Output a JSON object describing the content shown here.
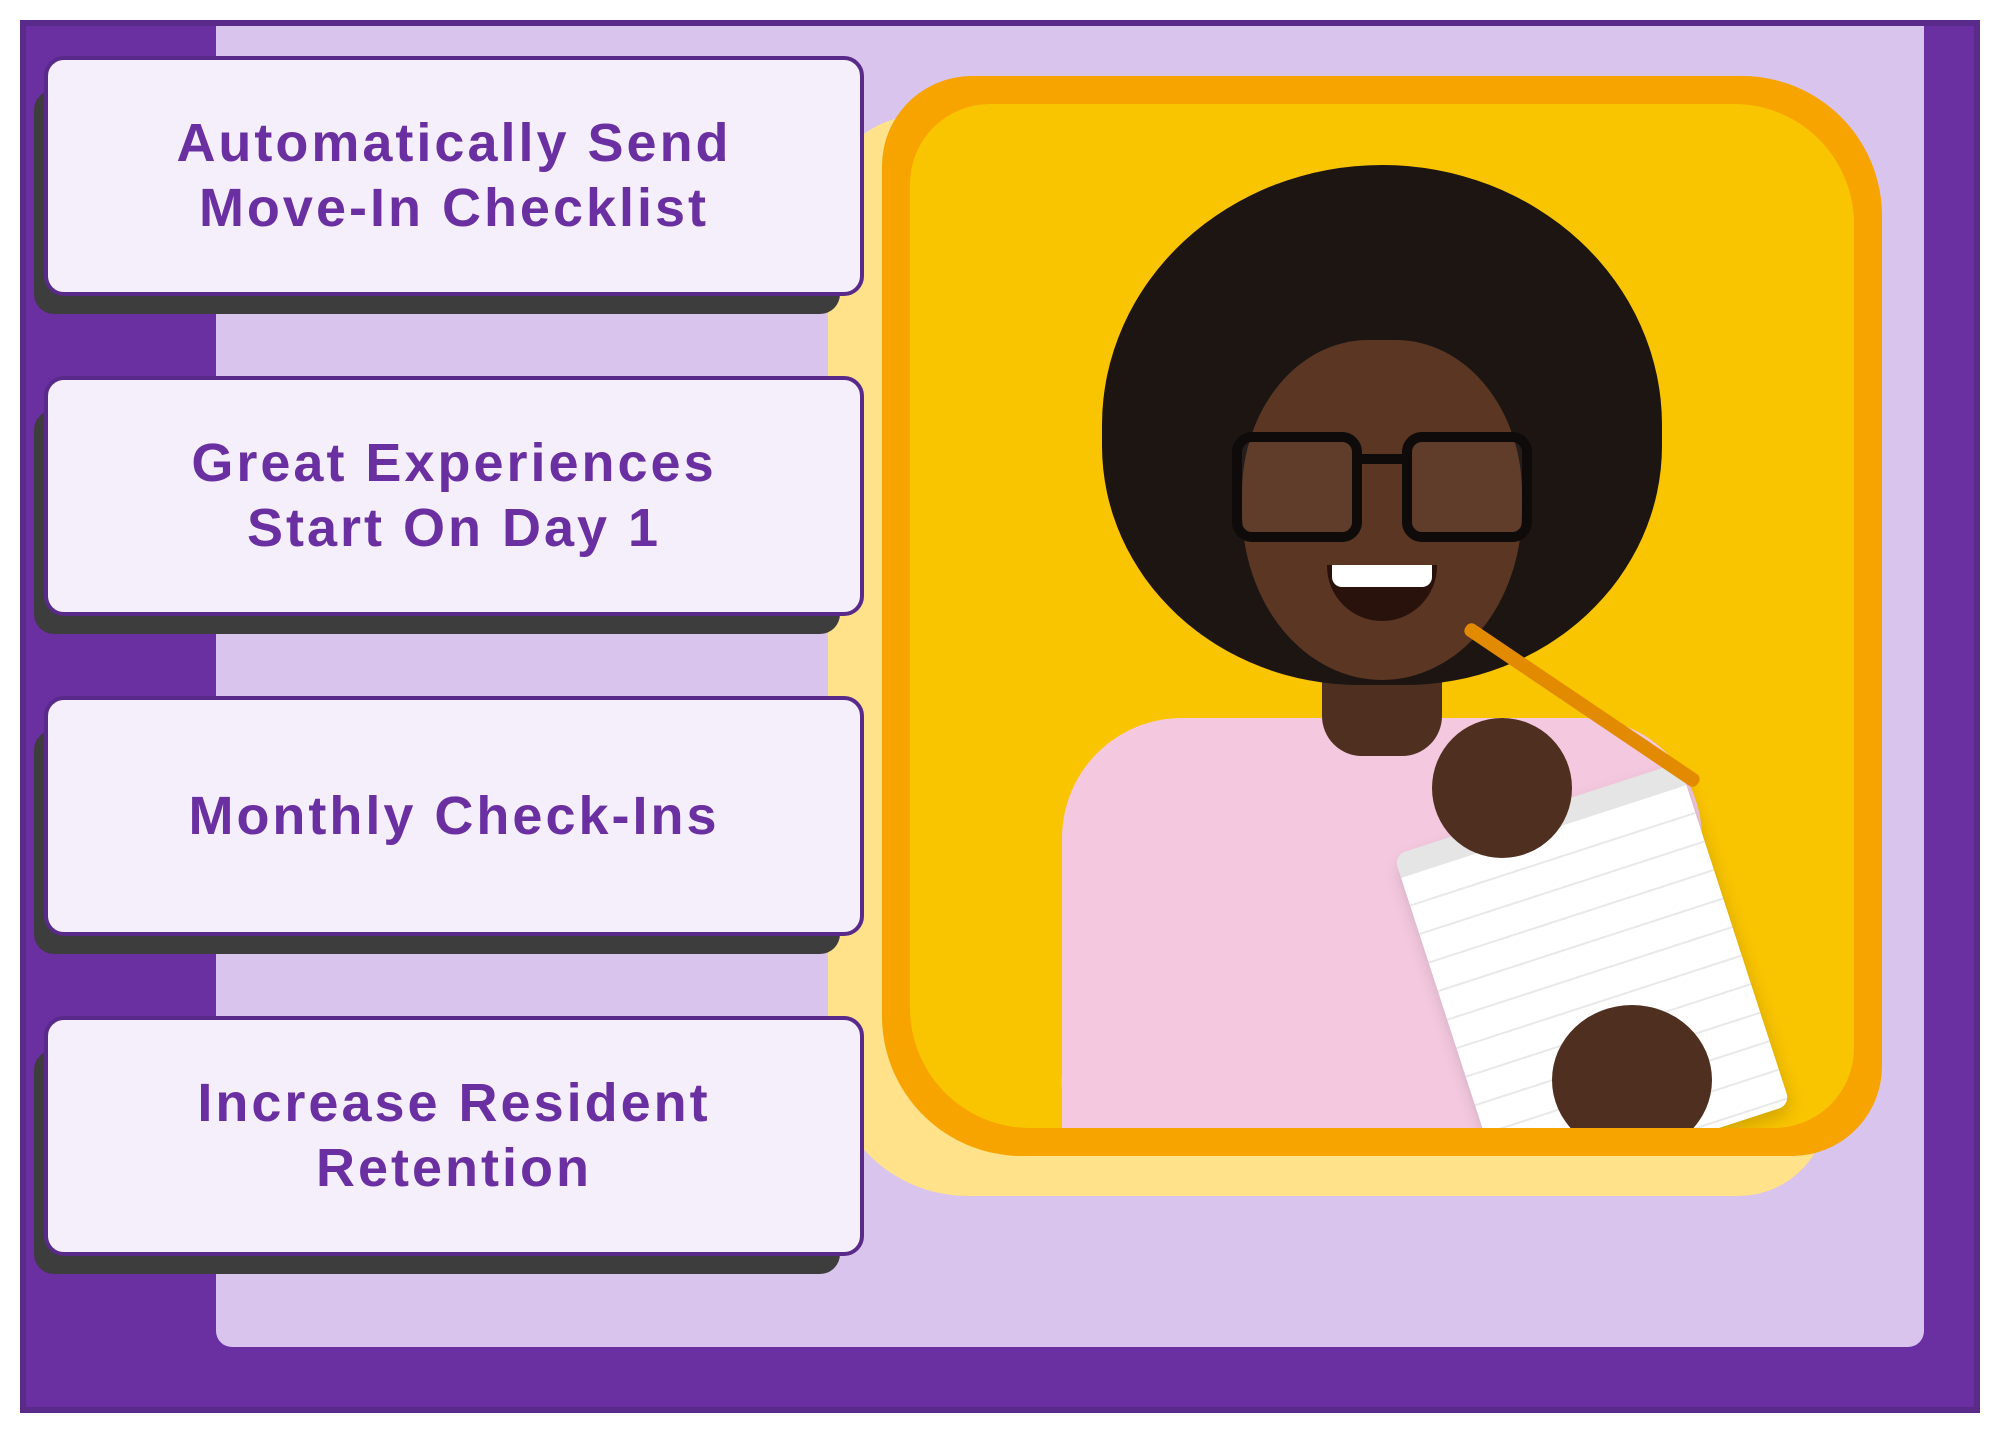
{
  "features": [
    {
      "label": "Automatically Send\nMove-In Checklist"
    },
    {
      "label": "Great Experiences\nStart On Day 1"
    },
    {
      "label": "Monthly Check-Ins"
    },
    {
      "label": "Increase Resident\nRetention"
    }
  ],
  "colors": {
    "brand_purple": "#6a2fa1",
    "brand_purple_dark": "#592a89",
    "panel_lilac": "#d8c4ec",
    "card_bg": "#f4effb",
    "accent_orange": "#f7a400",
    "accent_orange_light": "#ffe28a",
    "shadow": "#3d3d3d"
  },
  "image": {
    "alt": "Smiling woman with glasses writing on a notepad against a yellow background"
  }
}
